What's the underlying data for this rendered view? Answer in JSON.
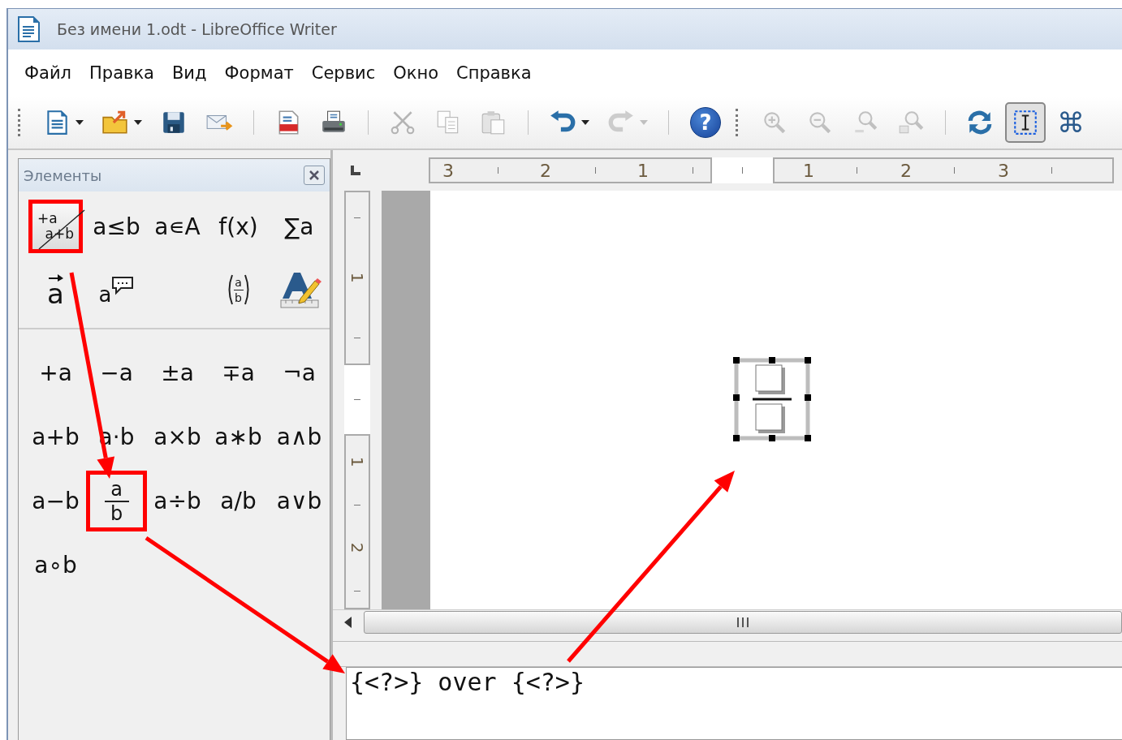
{
  "window": {
    "title": "Без имени 1.odt - LibreOffice Writer"
  },
  "menu": [
    {
      "label": "Файл"
    },
    {
      "label": "Правка"
    },
    {
      "label": "Вид"
    },
    {
      "label": "Формат"
    },
    {
      "label": "Сервис"
    },
    {
      "label": "Окно"
    },
    {
      "label": "Справка"
    }
  ],
  "toolbar": [
    {
      "kind": "grip"
    },
    {
      "kind": "button",
      "disabled": false,
      "dropdown": true,
      "pressed": false
    },
    {
      "kind": "button",
      "disabled": false,
      "dropdown": true,
      "pressed": false
    },
    {
      "kind": "button",
      "disabled": false,
      "dropdown": false,
      "pressed": false
    },
    {
      "kind": "button",
      "disabled": false,
      "dropdown": false,
      "pressed": false
    },
    {
      "kind": "separator"
    },
    {
      "kind": "button",
      "disabled": false,
      "dropdown": false,
      "pressed": false
    },
    {
      "kind": "button",
      "disabled": false,
      "dropdown": false,
      "pressed": false
    },
    {
      "kind": "separator"
    },
    {
      "kind": "button",
      "disabled": true,
      "dropdown": false,
      "pressed": false
    },
    {
      "kind": "button",
      "disabled": true,
      "dropdown": false,
      "pressed": false
    },
    {
      "kind": "button",
      "disabled": true,
      "dropdown": false,
      "pressed": false
    },
    {
      "kind": "separator"
    },
    {
      "kind": "button",
      "disabled": false,
      "dropdown": true,
      "pressed": false
    },
    {
      "kind": "button",
      "disabled": true,
      "dropdown": true,
      "pressed": false
    },
    {
      "kind": "separator"
    },
    {
      "kind": "help",
      "label": "?"
    },
    {
      "kind": "grip"
    },
    {
      "kind": "button",
      "disabled": true,
      "dropdown": false,
      "pressed": false
    },
    {
      "kind": "button",
      "disabled": true,
      "dropdown": false,
      "pressed": false
    },
    {
      "kind": "button",
      "disabled": true,
      "dropdown": false,
      "pressed": false
    },
    {
      "kind": "button",
      "disabled": true,
      "dropdown": false,
      "pressed": false
    },
    {
      "kind": "separator"
    },
    {
      "kind": "button",
      "disabled": false,
      "dropdown": false,
      "pressed": false
    },
    {
      "kind": "button",
      "disabled": false,
      "dropdown": false,
      "pressed": true
    },
    {
      "kind": "glyph",
      "label": "⌘"
    }
  ],
  "elements_panel": {
    "title": "Элементы",
    "categories": [
      {
        "kind": "slash-fraction",
        "top": "+a",
        "bottom": "a+b",
        "selected": true,
        "highlighted": true
      },
      {
        "kind": "text",
        "label": "a≤b",
        "selected": false,
        "highlighted": false
      },
      {
        "kind": "text",
        "label": "a∊A",
        "selected": false,
        "highlighted": false
      },
      {
        "kind": "text",
        "label": "f(x)",
        "selected": false,
        "highlighted": false
      },
      {
        "kind": "text",
        "label": "∑a",
        "selected": false,
        "highlighted": false
      },
      {
        "kind": "vector",
        "label": "a",
        "selected": false,
        "highlighted": false
      },
      {
        "kind": "attribute",
        "label": "a",
        "selected": false,
        "highlighted": false
      },
      {
        "kind": "blank"
      },
      {
        "kind": "bracket-fraction",
        "top": "a",
        "bottom": "b",
        "selected": false,
        "highlighted": false
      },
      {
        "kind": "format",
        "selected": false,
        "highlighted": false
      }
    ],
    "operations": [
      {
        "kind": "text",
        "label": "+a",
        "highlighted": false
      },
      {
        "kind": "text",
        "label": "−a",
        "highlighted": false
      },
      {
        "kind": "text",
        "label": "±a",
        "highlighted": false
      },
      {
        "kind": "text",
        "label": "∓a",
        "highlighted": false
      },
      {
        "kind": "text",
        "label": "¬a",
        "highlighted": false
      },
      {
        "kind": "text",
        "label": "a+b",
        "highlighted": false
      },
      {
        "kind": "text",
        "label": "a⋅b",
        "highlighted": false
      },
      {
        "kind": "text",
        "label": "a×b",
        "highlighted": false
      },
      {
        "kind": "text",
        "label": "a∗b",
        "highlighted": false
      },
      {
        "kind": "text",
        "label": "a∧b",
        "highlighted": false
      },
      {
        "kind": "text",
        "label": "a−b",
        "highlighted": false
      },
      {
        "kind": "fraction",
        "top": "a",
        "bottom": "b",
        "highlighted": true
      },
      {
        "kind": "text",
        "label": "a÷b",
        "highlighted": false
      },
      {
        "kind": "text",
        "label": "a/b",
        "highlighted": false
      },
      {
        "kind": "text",
        "label": "a∨b",
        "highlighted": false
      },
      {
        "kind": "text",
        "label": "a∘b",
        "highlighted": false
      }
    ]
  },
  "ruler": {
    "left_labels": [
      "3",
      "2",
      "1"
    ],
    "right_labels": [
      "1",
      "2",
      "3"
    ]
  },
  "vertical_ruler": {
    "labels": [
      "1",
      "1",
      "2"
    ]
  },
  "command_editor": {
    "value": "{<?>} over {<?>}"
  }
}
